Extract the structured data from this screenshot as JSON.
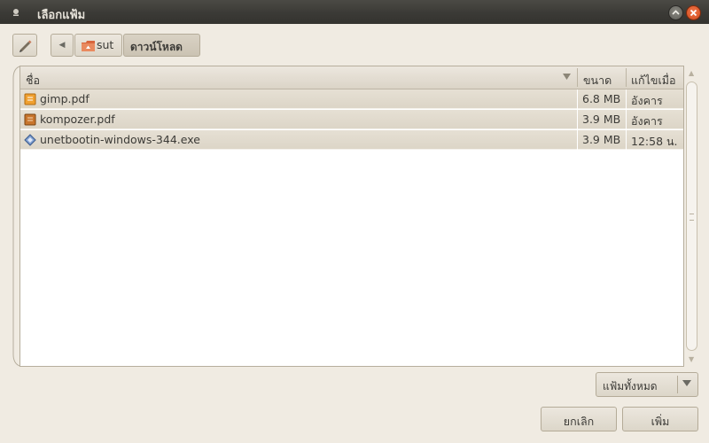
{
  "window": {
    "title": "เลือกแฟ้ม"
  },
  "path_bar": {
    "crumbs": [
      {
        "label": "sut",
        "icon": "home-folder-icon"
      },
      {
        "label": "ดาวน์โหลด"
      }
    ]
  },
  "file_list": {
    "columns": {
      "name": "ชื่อ",
      "size": "ขนาด",
      "modified": "แก้ไขเมื่อ"
    },
    "rows": [
      {
        "name": "gimp.pdf",
        "size": "6.8 MB",
        "modified": "อังคาร",
        "icon": "pdf-file-icon"
      },
      {
        "name": "kompozer.pdf",
        "size": "3.9 MB",
        "modified": "อังคาร",
        "icon": "pdf-file-icon"
      },
      {
        "name": "unetbootin-windows-344.exe",
        "size": "3.9 MB",
        "modified": "12:58 น.",
        "icon": "executable-file-icon"
      }
    ]
  },
  "filter": {
    "selected": "แฟ้มทั้งหมด"
  },
  "actions": {
    "cancel": "ยกเลิก",
    "add": "เพิ่ม"
  },
  "colors": {
    "titlebar": "#3b3a36",
    "close": "#d14b1c",
    "window_bg": "#f0ebe2"
  }
}
